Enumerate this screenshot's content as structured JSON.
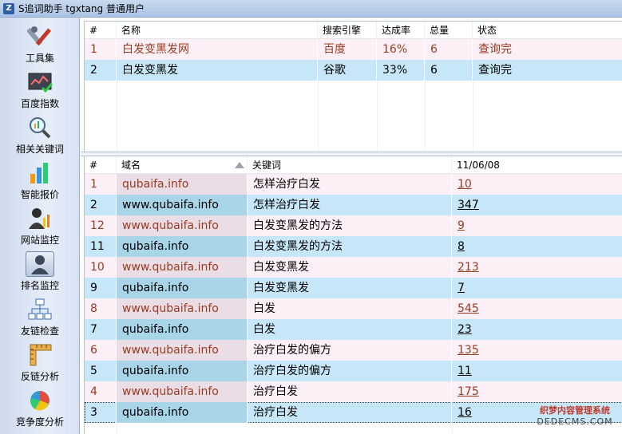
{
  "title_bar": {
    "icon_letter": "Z",
    "text": "S追词助手 tgxtang 普通用户"
  },
  "sidebar": {
    "items": [
      {
        "label": "工具集",
        "icon": "tools-icon"
      },
      {
        "label": "百度指数",
        "icon": "baidu-index-icon"
      },
      {
        "label": "相关关键词",
        "icon": "magnifier-icon"
      },
      {
        "label": "智能报价",
        "icon": "bar-chart-icon"
      },
      {
        "label": "网站监控",
        "icon": "user-monitor-icon"
      },
      {
        "label": "排名监控",
        "icon": "person-icon"
      },
      {
        "label": "友链检查",
        "icon": "sitemap-icon"
      },
      {
        "label": "反链分析",
        "icon": "ruler-icon"
      },
      {
        "label": "竞争度分析",
        "icon": "pie-chart-icon"
      }
    ],
    "active_index": 5
  },
  "top_table": {
    "headers": [
      "#",
      "名称",
      "搜索引擎",
      "达成率",
      "总量",
      "状态"
    ],
    "rows": [
      {
        "num": "1",
        "name": "白发变黑发网",
        "engine": "百度",
        "rate": "16%",
        "total": "6",
        "status": "查询完"
      },
      {
        "num": "2",
        "name": "白发变黑发",
        "engine": "谷歌",
        "rate": "33%",
        "total": "6",
        "status": "查询完"
      }
    ]
  },
  "bottom_table": {
    "headers": [
      "#",
      "域名",
      "关键词",
      "11/06/08"
    ],
    "rows": [
      {
        "num": "1",
        "domain": "qubaifa.info",
        "keyword": "怎样治疗白发",
        "rank": "10"
      },
      {
        "num": "2",
        "domain": "www.qubaifa.info",
        "keyword": "怎样治疗白发",
        "rank": "347"
      },
      {
        "num": "12",
        "domain": "www.qubaifa.info",
        "keyword": "白发变黑发的方法",
        "rank": "9"
      },
      {
        "num": "11",
        "domain": "qubaifa.info",
        "keyword": "白发变黑发的方法",
        "rank": "8"
      },
      {
        "num": "10",
        "domain": "www.qubaifa.info",
        "keyword": "白发变黑发",
        "rank": "213"
      },
      {
        "num": "9",
        "domain": "qubaifa.info",
        "keyword": "白发变黑发",
        "rank": "7"
      },
      {
        "num": "8",
        "domain": "www.qubaifa.info",
        "keyword": "白发",
        "rank": "545"
      },
      {
        "num": "7",
        "domain": "qubaifa.info",
        "keyword": "白发",
        "rank": "23"
      },
      {
        "num": "6",
        "domain": "www.qubaifa.info",
        "keyword": "治疗白发的偏方",
        "rank": "135"
      },
      {
        "num": "5",
        "domain": "qubaifa.info",
        "keyword": "治疗白发的偏方",
        "rank": "11"
      },
      {
        "num": "4",
        "domain": "www.qubaifa.info",
        "keyword": "治疗白发",
        "rank": "175"
      },
      {
        "num": "3",
        "domain": "qubaifa.info",
        "keyword": "治疗白发",
        "rank": "16"
      }
    ]
  },
  "watermark": {
    "line1": "织梦内容管理系统",
    "line2": "DEDECMS.COM"
  },
  "colors": {
    "row_pink": "#fdeff6",
    "row_blue": "#c6e7f7",
    "red_text": "#9a3b1e"
  }
}
